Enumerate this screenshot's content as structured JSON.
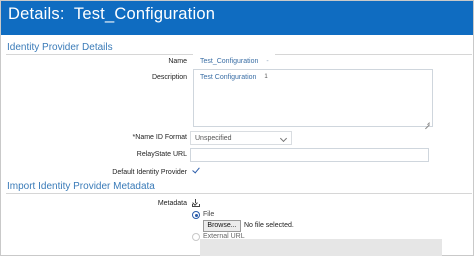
{
  "header": {
    "title": "Details:  Test_Configuration",
    "background": "#0f6cc1"
  },
  "identity_provider": {
    "heading": "Identity Provider Details",
    "name": {
      "label": "Name",
      "value": "Test_Configuration",
      "marker": "-"
    },
    "description": {
      "label": "Description",
      "value": "Test Configuration",
      "marker": "1"
    },
    "name_id_format": {
      "label": "Name ID Format",
      "required_mark": "*",
      "selected": "Unspecified"
    },
    "relaystate_url": {
      "label": "RelayState URL",
      "value": ""
    },
    "default_idp": {
      "label": "Default Identity Provider",
      "checked": true
    }
  },
  "metadata": {
    "heading": "Import Identity Provider Metadata",
    "label": "Metadata",
    "icon": "download-icon",
    "options": [
      {
        "label": "File",
        "selected": true
      },
      {
        "label": "External URL",
        "selected": false
      }
    ],
    "browse_label": "Browse...",
    "file_status": "No file selected."
  }
}
